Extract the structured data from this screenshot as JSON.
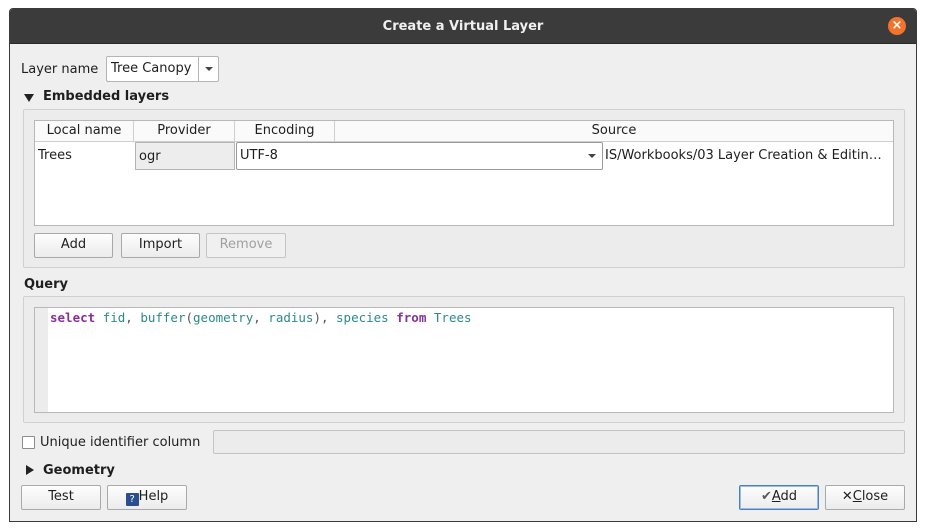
{
  "window": {
    "title": "Create a Virtual Layer"
  },
  "layer_name": {
    "label": "Layer name",
    "value": "Tree Canopy"
  },
  "embedded": {
    "title": "Embedded layers",
    "columns": [
      "Local name",
      "Provider",
      "Encoding",
      "Source"
    ],
    "row": {
      "local_name": "Trees",
      "provider": "ogr",
      "encoding": "UTF-8",
      "source": "IS/Workbooks/03 Layer Creation & Editin…"
    },
    "buttons": {
      "add": "Add",
      "import": "Import",
      "remove": "Remove"
    }
  },
  "query": {
    "title": "Query",
    "tokens": [
      {
        "t": "select",
        "c": "kw"
      },
      {
        "t": " ",
        "c": "pn"
      },
      {
        "t": "fid",
        "c": "id"
      },
      {
        "t": ", ",
        "c": "pn"
      },
      {
        "t": "buffer",
        "c": "id"
      },
      {
        "t": "(",
        "c": "pn"
      },
      {
        "t": "geometry",
        "c": "id"
      },
      {
        "t": ", ",
        "c": "pn"
      },
      {
        "t": "radius",
        "c": "id"
      },
      {
        "t": "), ",
        "c": "pn"
      },
      {
        "t": "species",
        "c": "id"
      },
      {
        "t": " ",
        "c": "pn"
      },
      {
        "t": "from",
        "c": "kw"
      },
      {
        "t": " ",
        "c": "pn"
      },
      {
        "t": "Trees",
        "c": "id"
      }
    ]
  },
  "unique_id": {
    "label": "Unique identifier column",
    "checked": false,
    "value": ""
  },
  "geometry": {
    "title": "Geometry"
  },
  "footer": {
    "test": "Test",
    "help": "Help",
    "help_icon": "?",
    "add_prefix": "",
    "add_underline": "A",
    "add_rest": "dd",
    "close_underline": "C",
    "close_rest": "lose"
  },
  "colors": {
    "accent_close": "#f2732a",
    "keyword": "#8a2f9e",
    "identifier": "#2a8a8e"
  }
}
